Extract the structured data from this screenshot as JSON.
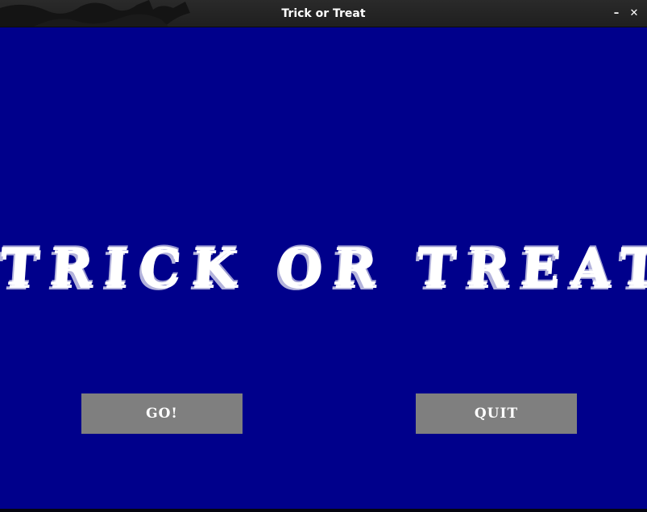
{
  "window": {
    "title": "Trick or Treat",
    "minimize_label": "–",
    "close_label": "✕"
  },
  "main": {
    "headline": "TRICK OR TREAT",
    "go_label": "GO!",
    "quit_label": "QUIT"
  },
  "colors": {
    "background": "#00008b",
    "button": "#7f7f7f",
    "text": "#ffffff",
    "titlebar": "#242424"
  },
  "icons": {
    "titlebar_decoration": "dragon-silhouette-icon",
    "minimize": "minimize-icon",
    "close": "close-icon"
  }
}
